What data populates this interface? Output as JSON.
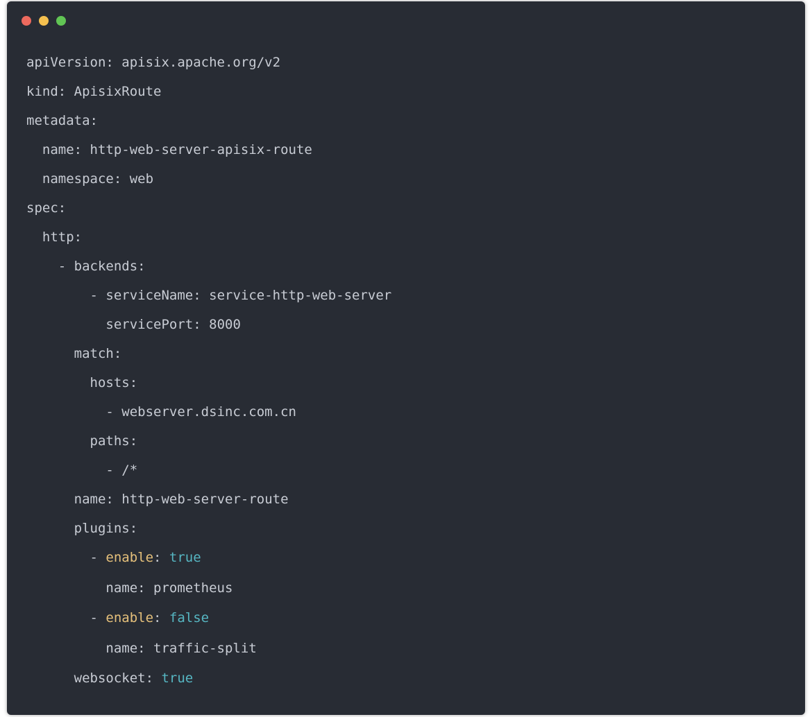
{
  "window": {
    "controls": {
      "close_color": "#ed6a5e",
      "minimize_color": "#f5c04f",
      "zoom_color": "#61c554"
    }
  },
  "code": {
    "lines": [
      {
        "indent": "",
        "key": "apiVersion",
        "sep": ": ",
        "value": "apisix.apache.org/v2",
        "key_style": "k",
        "value_style": "v"
      },
      {
        "indent": "",
        "key": "kind",
        "sep": ": ",
        "value": "ApisixRoute",
        "key_style": "k",
        "value_style": "v"
      },
      {
        "indent": "",
        "key": "metadata",
        "sep": ":",
        "value": "",
        "key_style": "k",
        "value_style": "v"
      },
      {
        "indent": "  ",
        "key": "name",
        "sep": ": ",
        "value": "http-web-server-apisix-route",
        "key_style": "k",
        "value_style": "v"
      },
      {
        "indent": "  ",
        "key": "namespace",
        "sep": ": ",
        "value": "web",
        "key_style": "k",
        "value_style": "v"
      },
      {
        "indent": "",
        "key": "spec",
        "sep": ":",
        "value": "",
        "key_style": "k",
        "value_style": "v"
      },
      {
        "indent": "  ",
        "key": "http",
        "sep": ":",
        "value": "",
        "key_style": "k",
        "value_style": "v"
      },
      {
        "indent": "    - ",
        "key": "backends",
        "sep": ":",
        "value": "",
        "key_style": "k",
        "value_style": "v"
      },
      {
        "indent": "        - ",
        "key": "serviceName",
        "sep": ": ",
        "value": "service-http-web-server",
        "key_style": "k",
        "value_style": "v"
      },
      {
        "indent": "          ",
        "key": "servicePort",
        "sep": ": ",
        "value": "8000",
        "key_style": "k",
        "value_style": "v"
      },
      {
        "indent": "      ",
        "key": "match",
        "sep": ":",
        "value": "",
        "key_style": "k",
        "value_style": "v"
      },
      {
        "indent": "        ",
        "key": "hosts",
        "sep": ":",
        "value": "",
        "key_style": "k",
        "value_style": "v"
      },
      {
        "indent": "          - ",
        "key": "",
        "sep": "",
        "value": "webserver.dsinc.com.cn",
        "key_style": "k",
        "value_style": "v"
      },
      {
        "indent": "        ",
        "key": "paths",
        "sep": ":",
        "value": "",
        "key_style": "k",
        "value_style": "v"
      },
      {
        "indent": "          - ",
        "key": "",
        "sep": "",
        "value": "/*",
        "key_style": "k",
        "value_style": "v"
      },
      {
        "indent": "      ",
        "key": "name",
        "sep": ": ",
        "value": "http-web-server-route",
        "key_style": "k",
        "value_style": "v"
      },
      {
        "indent": "      ",
        "key": "plugins",
        "sep": ":",
        "value": "",
        "key_style": "k",
        "value_style": "v"
      },
      {
        "indent": "        - ",
        "key": "enable",
        "sep": ": ",
        "value": "true",
        "key_style": "kw",
        "value_style": "bool",
        "tall": true
      },
      {
        "indent": "          ",
        "key": "name",
        "sep": ": ",
        "value": "prometheus",
        "key_style": "k",
        "value_style": "v",
        "tall": true
      },
      {
        "indent": "        - ",
        "key": "enable",
        "sep": ": ",
        "value": "false",
        "key_style": "kw",
        "value_style": "bool",
        "tall": true
      },
      {
        "indent": "          ",
        "key": "name",
        "sep": ": ",
        "value": "traffic-split",
        "key_style": "k",
        "value_style": "v",
        "tall": true
      },
      {
        "indent": "      ",
        "key": "websocket",
        "sep": ": ",
        "value": "true",
        "key_style": "k",
        "value_style": "bool",
        "tall": true
      }
    ]
  }
}
